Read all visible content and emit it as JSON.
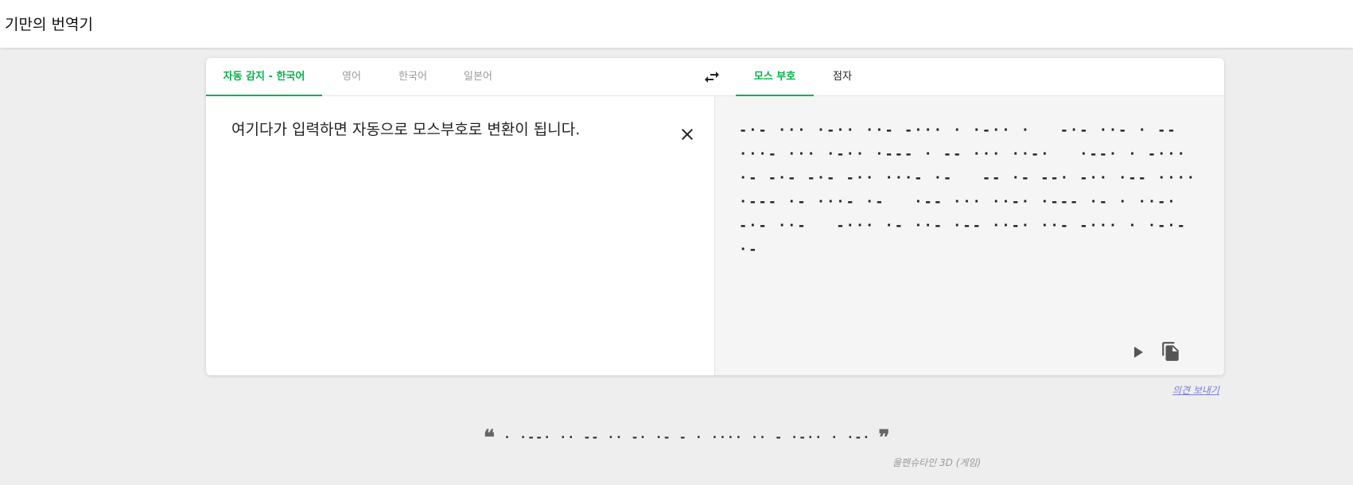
{
  "app": {
    "title": "기만의 번역기"
  },
  "source_tabs": [
    {
      "label": "자동 감지 - 한국어",
      "active": true
    },
    {
      "label": "영어",
      "active": false
    },
    {
      "label": "한국어",
      "active": false
    },
    {
      "label": "일본어",
      "active": false
    }
  ],
  "target_tabs": [
    {
      "label": "모스 부호",
      "active": true
    },
    {
      "label": "점자",
      "active": false
    }
  ],
  "icons": {
    "swap": "swap-arrows-icon",
    "clear": "close-icon",
    "play": "play-icon",
    "copy": "copy-icon"
  },
  "source": {
    "text": "여기다가 입력하면 자동으로 모스부호로 변환이 됩니다."
  },
  "result": {
    "text": "-·- ··· ·-·· ··- -··· · ·-·· ·   -·- ··- · -- ···- ··· ·-·· ·--- · -- ··· ··-·   ·--· · -··· ·- -·- -·- -·· ···- ·-   -- ·- --· -·· ·-- ···· ·--- ·- ···- ·-   ·-- ··· ··-· ·--- ·- · ··-· -·- ··-   -··· ·- ··- ·-- ··-· ··- -··· · ·-·-·-"
  },
  "feedback": {
    "label": "의견 보내기"
  },
  "quote": {
    "open_mark": "❝",
    "text": "· ·--· ·· -- ·· -· ·- - ·   ···· ·· - ·-·· · ·-·",
    "close_mark": "❞",
    "source": "울펜슈타인 3D (게임)"
  },
  "colors": {
    "accent": "#06b24a",
    "background": "#eeeeee",
    "result_pane": "#f5f5f5",
    "link": "#7b7bdc"
  }
}
